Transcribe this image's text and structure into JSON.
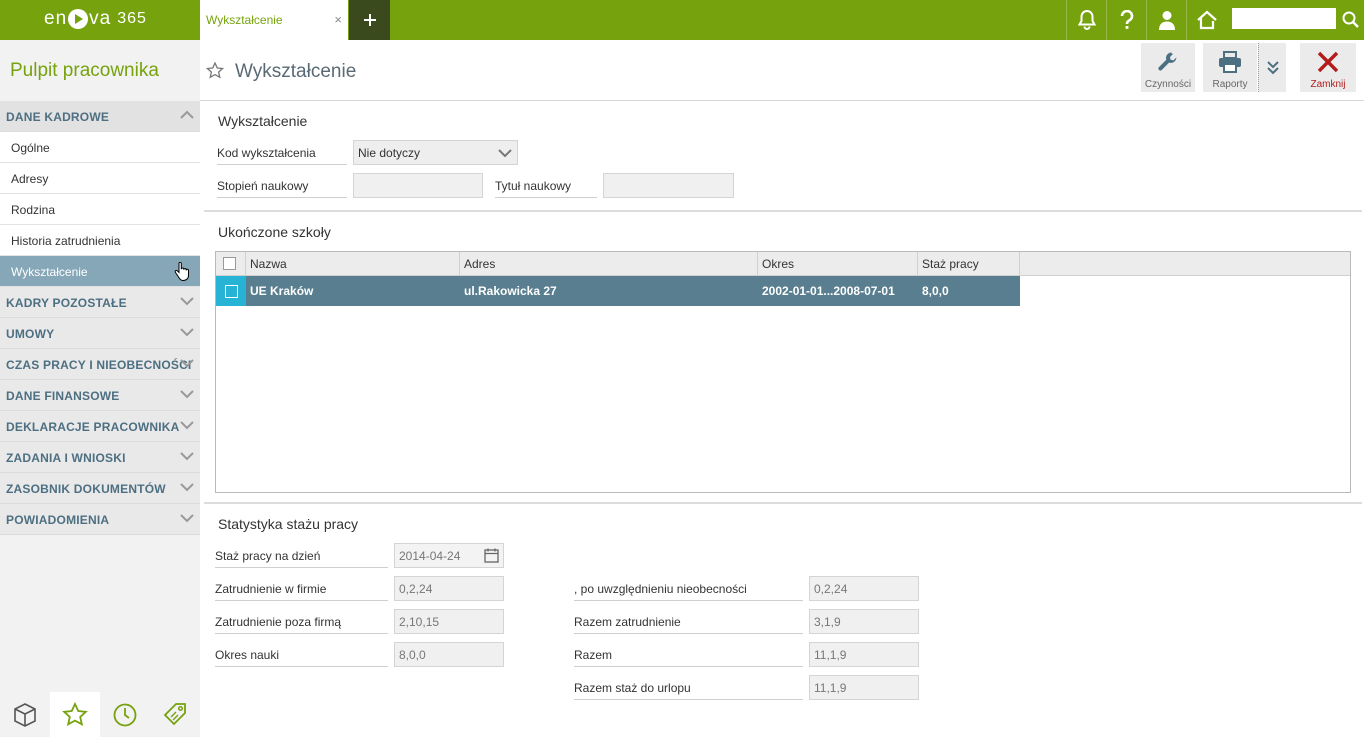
{
  "app": {
    "logo_left": "en",
    "logo_right": "va",
    "logo_num": "365"
  },
  "tabs": {
    "active_label": "Wykształcenie",
    "close_glyph": "×",
    "add_glyph": "+"
  },
  "sidebar": {
    "title": "Pulpit pracownika",
    "sections": [
      {
        "label": "DANE KADROWE",
        "expanded": true,
        "items": [
          "Ogólne",
          "Adresy",
          "Rodzina",
          "Historia zatrudnienia",
          "Wykształcenie"
        ],
        "active_item": "Wykształcenie"
      },
      {
        "label": "KADRY POZOSTAŁE"
      },
      {
        "label": "UMOWY"
      },
      {
        "label": "CZAS PRACY I NIEOBECNOŚCI"
      },
      {
        "label": "DANE FINANSOWE"
      },
      {
        "label": "DEKLARACJE PRACOWNIKA"
      },
      {
        "label": "ZADANIA I WNIOSKI"
      },
      {
        "label": "ZASOBNIK DOKUMENTÓW"
      },
      {
        "label": "POWIADOMIENIA"
      }
    ]
  },
  "page": {
    "title": "Wykształcenie"
  },
  "toolbar": {
    "actions_label": "Czynności",
    "reports_label": "Raporty",
    "close_label": "Zamknij"
  },
  "education": {
    "title": "Wykształcenie",
    "code_label": "Kod wykształcenia",
    "code_value": "Nie dotyczy",
    "degree_label": "Stopień naukowy",
    "degree_value": "",
    "title_label": "Tytuł naukowy",
    "title_value": ""
  },
  "schools": {
    "title": "Ukończone szkoły",
    "columns": [
      "Nazwa",
      "Adres",
      "Okres",
      "Staż pracy"
    ],
    "rows": [
      {
        "name": "UE Kraków",
        "address": "ul.Rakowicka 27",
        "period": "2002-01-01...2008-07-01",
        "seniority": "8,0,0"
      }
    ]
  },
  "stats": {
    "title": "Statystyka stażu pracy",
    "as_of_label": "Staż pracy na dzień",
    "as_of_value": "2014-04-24",
    "left": [
      {
        "label": "Zatrudnienie w firmie",
        "value": "0,2,24"
      },
      {
        "label": "Zatrudnienie poza firmą",
        "value": "2,10,15"
      },
      {
        "label": "Okres nauki",
        "value": "8,0,0"
      }
    ],
    "right": [
      {
        "label": ", po uwzględnieniu nieobecności",
        "value": "0,2,24"
      },
      {
        "label": "Razem zatrudnienie",
        "value": "3,1,9"
      },
      {
        "label": "Razem",
        "value": "11,1,9"
      },
      {
        "label": "Razem staż do urlopu",
        "value": "11,1,9"
      }
    ]
  },
  "colors": {
    "brand": "#76a20d",
    "selected_row": "#597e8f",
    "sidebar_active": "#86a7b8",
    "section_text": "#4d6f82"
  }
}
